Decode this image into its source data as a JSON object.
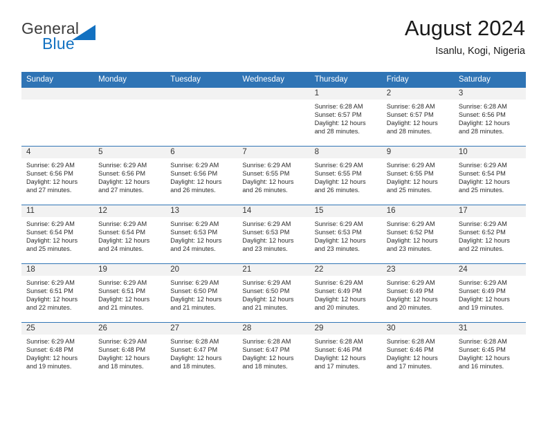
{
  "brand": {
    "name_part1": "General",
    "name_part2": "Blue",
    "logo_icon": "triangle-flag-icon",
    "accent_color": "#1271c1"
  },
  "header": {
    "title": "August 2024",
    "subtitle": "Isanlu, Kogi, Nigeria"
  },
  "calendar": {
    "header_bg": "#2f74b5",
    "daynum_bg": "#f2f2f2",
    "weekdays": [
      "Sunday",
      "Monday",
      "Tuesday",
      "Wednesday",
      "Thursday",
      "Friday",
      "Saturday"
    ],
    "weeks": [
      [
        {
          "day": "",
          "sunrise": "",
          "sunset": "",
          "daylight1": "",
          "daylight2": ""
        },
        {
          "day": "",
          "sunrise": "",
          "sunset": "",
          "daylight1": "",
          "daylight2": ""
        },
        {
          "day": "",
          "sunrise": "",
          "sunset": "",
          "daylight1": "",
          "daylight2": ""
        },
        {
          "day": "",
          "sunrise": "",
          "sunset": "",
          "daylight1": "",
          "daylight2": ""
        },
        {
          "day": "1",
          "sunrise": "Sunrise: 6:28 AM",
          "sunset": "Sunset: 6:57 PM",
          "daylight1": "Daylight: 12 hours",
          "daylight2": "and 28 minutes."
        },
        {
          "day": "2",
          "sunrise": "Sunrise: 6:28 AM",
          "sunset": "Sunset: 6:57 PM",
          "daylight1": "Daylight: 12 hours",
          "daylight2": "and 28 minutes."
        },
        {
          "day": "3",
          "sunrise": "Sunrise: 6:28 AM",
          "sunset": "Sunset: 6:56 PM",
          "daylight1": "Daylight: 12 hours",
          "daylight2": "and 28 minutes."
        }
      ],
      [
        {
          "day": "4",
          "sunrise": "Sunrise: 6:29 AM",
          "sunset": "Sunset: 6:56 PM",
          "daylight1": "Daylight: 12 hours",
          "daylight2": "and 27 minutes."
        },
        {
          "day": "5",
          "sunrise": "Sunrise: 6:29 AM",
          "sunset": "Sunset: 6:56 PM",
          "daylight1": "Daylight: 12 hours",
          "daylight2": "and 27 minutes."
        },
        {
          "day": "6",
          "sunrise": "Sunrise: 6:29 AM",
          "sunset": "Sunset: 6:56 PM",
          "daylight1": "Daylight: 12 hours",
          "daylight2": "and 26 minutes."
        },
        {
          "day": "7",
          "sunrise": "Sunrise: 6:29 AM",
          "sunset": "Sunset: 6:55 PM",
          "daylight1": "Daylight: 12 hours",
          "daylight2": "and 26 minutes."
        },
        {
          "day": "8",
          "sunrise": "Sunrise: 6:29 AM",
          "sunset": "Sunset: 6:55 PM",
          "daylight1": "Daylight: 12 hours",
          "daylight2": "and 26 minutes."
        },
        {
          "day": "9",
          "sunrise": "Sunrise: 6:29 AM",
          "sunset": "Sunset: 6:55 PM",
          "daylight1": "Daylight: 12 hours",
          "daylight2": "and 25 minutes."
        },
        {
          "day": "10",
          "sunrise": "Sunrise: 6:29 AM",
          "sunset": "Sunset: 6:54 PM",
          "daylight1": "Daylight: 12 hours",
          "daylight2": "and 25 minutes."
        }
      ],
      [
        {
          "day": "11",
          "sunrise": "Sunrise: 6:29 AM",
          "sunset": "Sunset: 6:54 PM",
          "daylight1": "Daylight: 12 hours",
          "daylight2": "and 25 minutes."
        },
        {
          "day": "12",
          "sunrise": "Sunrise: 6:29 AM",
          "sunset": "Sunset: 6:54 PM",
          "daylight1": "Daylight: 12 hours",
          "daylight2": "and 24 minutes."
        },
        {
          "day": "13",
          "sunrise": "Sunrise: 6:29 AM",
          "sunset": "Sunset: 6:53 PM",
          "daylight1": "Daylight: 12 hours",
          "daylight2": "and 24 minutes."
        },
        {
          "day": "14",
          "sunrise": "Sunrise: 6:29 AM",
          "sunset": "Sunset: 6:53 PM",
          "daylight1": "Daylight: 12 hours",
          "daylight2": "and 23 minutes."
        },
        {
          "day": "15",
          "sunrise": "Sunrise: 6:29 AM",
          "sunset": "Sunset: 6:53 PM",
          "daylight1": "Daylight: 12 hours",
          "daylight2": "and 23 minutes."
        },
        {
          "day": "16",
          "sunrise": "Sunrise: 6:29 AM",
          "sunset": "Sunset: 6:52 PM",
          "daylight1": "Daylight: 12 hours",
          "daylight2": "and 23 minutes."
        },
        {
          "day": "17",
          "sunrise": "Sunrise: 6:29 AM",
          "sunset": "Sunset: 6:52 PM",
          "daylight1": "Daylight: 12 hours",
          "daylight2": "and 22 minutes."
        }
      ],
      [
        {
          "day": "18",
          "sunrise": "Sunrise: 6:29 AM",
          "sunset": "Sunset: 6:51 PM",
          "daylight1": "Daylight: 12 hours",
          "daylight2": "and 22 minutes."
        },
        {
          "day": "19",
          "sunrise": "Sunrise: 6:29 AM",
          "sunset": "Sunset: 6:51 PM",
          "daylight1": "Daylight: 12 hours",
          "daylight2": "and 21 minutes."
        },
        {
          "day": "20",
          "sunrise": "Sunrise: 6:29 AM",
          "sunset": "Sunset: 6:50 PM",
          "daylight1": "Daylight: 12 hours",
          "daylight2": "and 21 minutes."
        },
        {
          "day": "21",
          "sunrise": "Sunrise: 6:29 AM",
          "sunset": "Sunset: 6:50 PM",
          "daylight1": "Daylight: 12 hours",
          "daylight2": "and 21 minutes."
        },
        {
          "day": "22",
          "sunrise": "Sunrise: 6:29 AM",
          "sunset": "Sunset: 6:49 PM",
          "daylight1": "Daylight: 12 hours",
          "daylight2": "and 20 minutes."
        },
        {
          "day": "23",
          "sunrise": "Sunrise: 6:29 AM",
          "sunset": "Sunset: 6:49 PM",
          "daylight1": "Daylight: 12 hours",
          "daylight2": "and 20 minutes."
        },
        {
          "day": "24",
          "sunrise": "Sunrise: 6:29 AM",
          "sunset": "Sunset: 6:49 PM",
          "daylight1": "Daylight: 12 hours",
          "daylight2": "and 19 minutes."
        }
      ],
      [
        {
          "day": "25",
          "sunrise": "Sunrise: 6:29 AM",
          "sunset": "Sunset: 6:48 PM",
          "daylight1": "Daylight: 12 hours",
          "daylight2": "and 19 minutes."
        },
        {
          "day": "26",
          "sunrise": "Sunrise: 6:29 AM",
          "sunset": "Sunset: 6:48 PM",
          "daylight1": "Daylight: 12 hours",
          "daylight2": "and 18 minutes."
        },
        {
          "day": "27",
          "sunrise": "Sunrise: 6:28 AM",
          "sunset": "Sunset: 6:47 PM",
          "daylight1": "Daylight: 12 hours",
          "daylight2": "and 18 minutes."
        },
        {
          "day": "28",
          "sunrise": "Sunrise: 6:28 AM",
          "sunset": "Sunset: 6:47 PM",
          "daylight1": "Daylight: 12 hours",
          "daylight2": "and 18 minutes."
        },
        {
          "day": "29",
          "sunrise": "Sunrise: 6:28 AM",
          "sunset": "Sunset: 6:46 PM",
          "daylight1": "Daylight: 12 hours",
          "daylight2": "and 17 minutes."
        },
        {
          "day": "30",
          "sunrise": "Sunrise: 6:28 AM",
          "sunset": "Sunset: 6:46 PM",
          "daylight1": "Daylight: 12 hours",
          "daylight2": "and 17 minutes."
        },
        {
          "day": "31",
          "sunrise": "Sunrise: 6:28 AM",
          "sunset": "Sunset: 6:45 PM",
          "daylight1": "Daylight: 12 hours",
          "daylight2": "and 16 minutes."
        }
      ]
    ]
  }
}
